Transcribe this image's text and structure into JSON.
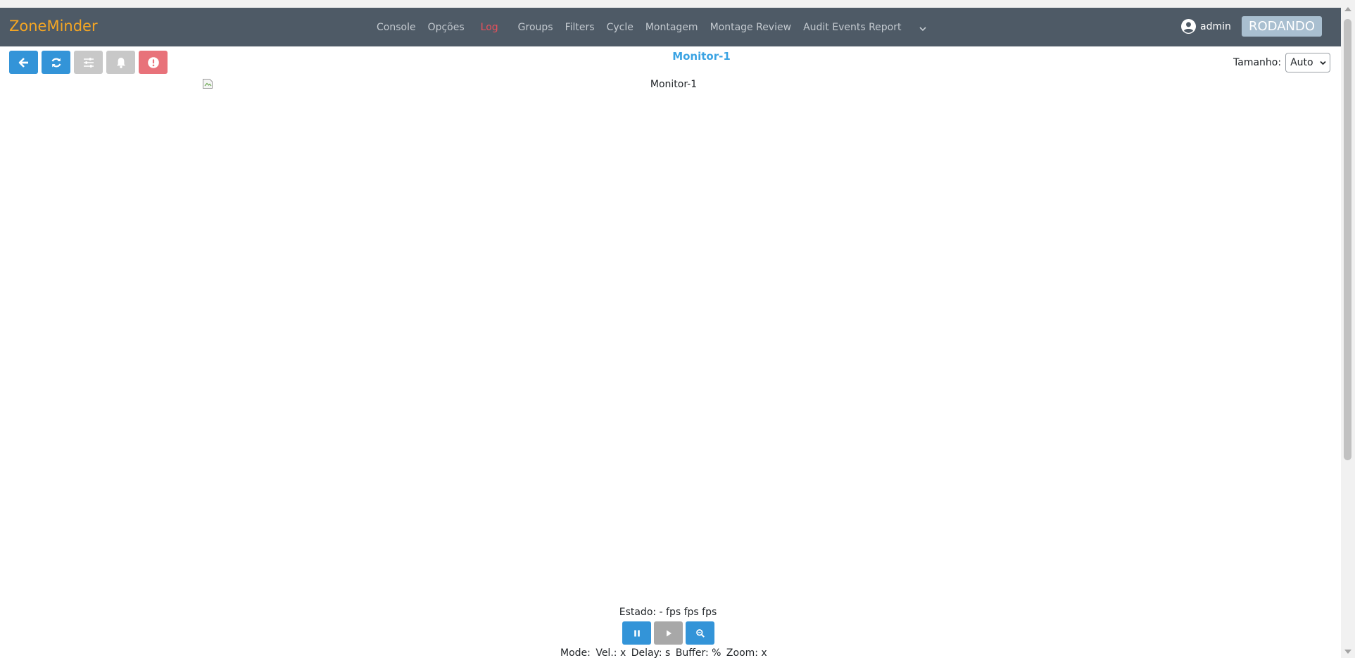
{
  "app": {
    "brand": "ZoneMinder"
  },
  "nav": {
    "items": [
      {
        "label": "Console",
        "key": "console"
      },
      {
        "label": "Opções",
        "key": "options"
      },
      {
        "label": "Log",
        "key": "log"
      },
      {
        "label": "Groups",
        "key": "groups"
      },
      {
        "label": "Filters",
        "key": "filters"
      },
      {
        "label": "Cycle",
        "key": "cycle"
      },
      {
        "label": "Montagem",
        "key": "montage"
      },
      {
        "label": "Montage Review",
        "key": "montage-review"
      },
      {
        "label": "Audit Events Report",
        "key": "audit-events-report"
      }
    ],
    "more_icon": "chevron-down-icon"
  },
  "user": {
    "name": "admin",
    "icon": "user-circle-icon"
  },
  "run_state": {
    "label": "RODANDO"
  },
  "toolbar": {
    "buttons": [
      {
        "name": "back-button",
        "icon": "arrow-left-icon",
        "color": "#3394d8"
      },
      {
        "name": "refresh-button",
        "icon": "refresh-icon",
        "color": "#3394d8"
      },
      {
        "name": "settings-button",
        "icon": "sliders-icon",
        "color": "#c8c8c8"
      },
      {
        "name": "alarm-button",
        "icon": "bell-icon",
        "color": "#c8c8c8"
      },
      {
        "name": "force-alarm-button",
        "icon": "exclamation-circle-icon",
        "color": "#e8727a"
      }
    ]
  },
  "monitor": {
    "title": "Monitor-1",
    "image_alt": "Monitor-1"
  },
  "size_control": {
    "label": "Tamanho:",
    "selected": "Auto"
  },
  "status": {
    "text": "Estado: - fps fps fps"
  },
  "controls": {
    "buttons": [
      {
        "name": "pause-button",
        "icon": "pause-icon",
        "color": "#3394d8"
      },
      {
        "name": "play-button",
        "icon": "play-icon",
        "color": "#a8a8a8"
      },
      {
        "name": "zoom-button",
        "icon": "zoom-icon",
        "color": "#3394d8"
      }
    ]
  },
  "info": {
    "mode": "Mode:",
    "speed": "Vel.: x",
    "delay": "Delay: s",
    "buffer": "Buffer: %",
    "zoom": "Zoom: x"
  },
  "colors": {
    "navbar": "#4e5a66",
    "brand": "#f5a623",
    "accent": "#3394d8",
    "log_link": "#e8505b",
    "title": "#3aa3e3"
  }
}
